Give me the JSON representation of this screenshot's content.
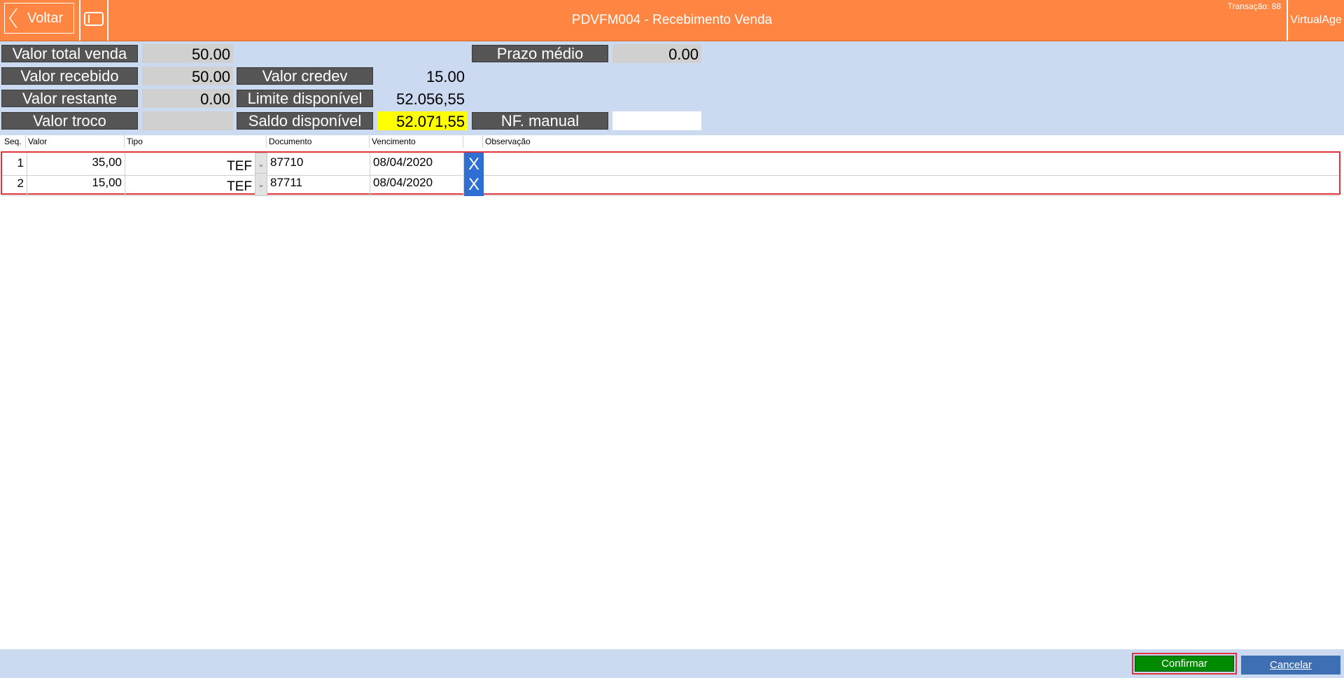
{
  "header": {
    "back_label": "Voltar",
    "title": "PDVFM004 - Recebimento Venda",
    "transacao": "Transação: 88",
    "vendor_label": "VirtualAge",
    "color": "#fe8542"
  },
  "summary": {
    "valor_total_venda": {
      "label": "Valor total venda",
      "value": "50.00"
    },
    "valor_recebido": {
      "label": "Valor recebido",
      "value": "50.00"
    },
    "valor_restante": {
      "label": "Valor restante",
      "value": "0.00"
    },
    "valor_troco": {
      "label": "Valor troco",
      "value": ""
    },
    "valor_credev": {
      "label": "Valor credev",
      "value": "15.00"
    },
    "limite_disponivel": {
      "label": "Limite disponível",
      "value": "52.056,55"
    },
    "saldo_disponivel": {
      "label": "Saldo disponível",
      "value": "52.071,55"
    },
    "prazo_medio": {
      "label": "Prazo médio",
      "value": "0.00"
    },
    "nf_manual": {
      "label": "NF. manual",
      "value": ""
    }
  },
  "grid": {
    "columns": [
      "Seq.",
      "Valor",
      "Tipo",
      "Documento",
      "Vencimento",
      "Observação"
    ],
    "rows": [
      {
        "seq": "1",
        "valor": "35,00",
        "tipo": "TEF",
        "documento": "87710",
        "vencimento": "08/04/2020",
        "observacao": ""
      },
      {
        "seq": "2",
        "valor": "15,00",
        "tipo": "TEF",
        "documento": "87711",
        "vencimento": "08/04/2020",
        "observacao": ""
      }
    ],
    "delete_glyph": "X"
  },
  "footer": {
    "confirm_label": "Confirmar",
    "cancel_label": "Cancelar",
    "confirm_color": "#008a00",
    "cancel_color": "#3e6fb3"
  }
}
